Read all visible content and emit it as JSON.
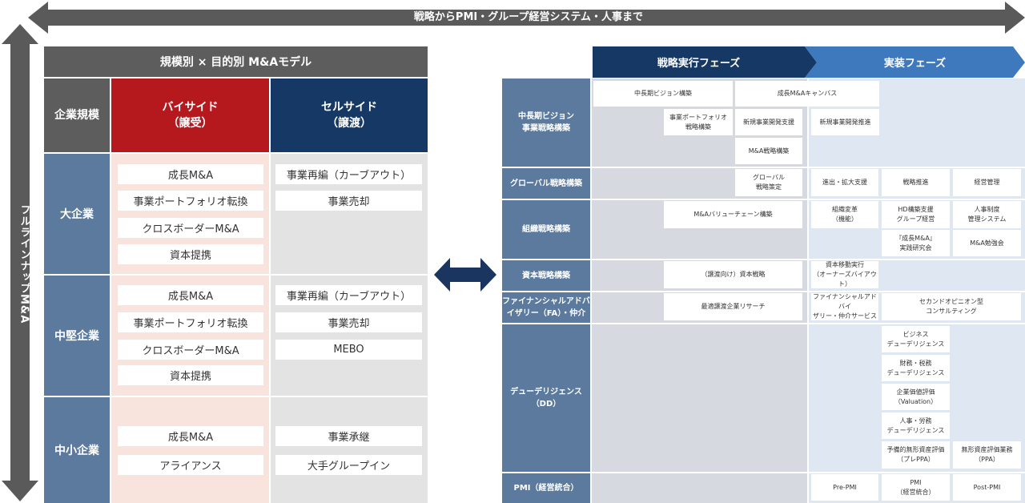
{
  "top_arrow_label": "戦略からPMI・グループ経営システム・人事まで",
  "left_arrow_label": "フルラインナップM&A",
  "model": {
    "title": "規模別 × 目的別 M&Aモデル",
    "header_scale": "企業規模",
    "buy_title": "バイサイド",
    "buy_sub": "（譲受）",
    "sell_title": "セルサイド",
    "sell_sub": "（譲渡）",
    "rows": [
      {
        "label": "大企業",
        "buy": [
          "成長M&A",
          "事業ポートフォリオ転換",
          "クロスボーダーM&A",
          "資本提携"
        ],
        "sell": [
          "事業再編（カーブアウト）",
          "事業売却"
        ]
      },
      {
        "label": "中堅企業",
        "buy": [
          "成長M&A",
          "事業ポートフォリオ転換",
          "クロスボーダーM&A",
          "資本提携"
        ],
        "sell": [
          "事業再編（カーブアウト）",
          "事業売却",
          "MEBO"
        ]
      },
      {
        "label": "中小企業",
        "buy": [
          "成長M&A",
          "アライアンス"
        ],
        "sell": [
          "事業承継",
          "大手グループイン"
        ]
      }
    ]
  },
  "phases": {
    "strategy": "戦略実行フェーズ",
    "implement": "実装フェーズ"
  },
  "process": {
    "rows": [
      {
        "label1": "中長期ビジョン",
        "label2": "事業戦略構築"
      },
      {
        "label1": "グローバル戦略構築",
        "label2": ""
      },
      {
        "label1": "組織戦略構築",
        "label2": ""
      },
      {
        "label1": "資本戦略構築",
        "label2": ""
      },
      {
        "label1": "ファイナンシャルアドバ",
        "label2": "イザリー（FA）・仲介"
      },
      {
        "label1": "デューデリジェンス",
        "label2": "（DD）"
      },
      {
        "label1": "PMI（経営統合）",
        "label2": ""
      }
    ],
    "items": {
      "vision_plan": "中長期ビジョン構築",
      "growth_canvas": "成長M&Aキャンバス",
      "portfolio_l1": "事業ポートフォリオ",
      "portfolio_l2": "戦略構築",
      "new_biz_support": "新規事業開発支援",
      "new_biz_promote": "新規事業開発推進",
      "ma_strategy": "M&A戦略構築",
      "global_l1": "グローバル",
      "global_l2": "戦略策定",
      "expansion": "進出・拡大支援",
      "strategy_promote": "戦略推進",
      "management": "経営管理",
      "value_chain": "M&Aバリューチェーン構築",
      "org_change_l1": "組織変革",
      "org_change_l2": "（機能）",
      "hd_l1": "HD構築支援",
      "hd_l2": "グループ経営",
      "hr_l1": "人事制度",
      "hr_l2": "管理システム",
      "study_l1": "『成長M&A』",
      "study_l2": "実践研究会",
      "study_meeting": "M&A勉強会",
      "capital_strategy": "（譲渡向け）資本戦略",
      "capital_move_l1": "資本移動実行",
      "capital_move_l2": "（オーナーズバイアウト）",
      "research": "最適譲渡企業リサーチ",
      "fa_l1": "ファイナンシャルアドバイ",
      "fa_l2": "ザリー・仲介サービス",
      "second_l1": "セカンドオピニオン型",
      "second_l2": "コンサルティング",
      "dd_biz_l1": "ビジネス",
      "dd_biz_l2": "デューデリジェンス",
      "dd_fin_l1": "財務・税務",
      "dd_fin_l2": "デューデリジェンス",
      "dd_val_l1": "企業価値評価",
      "dd_val_l2": "（Valuation）",
      "dd_hr_l1": "人事・労務",
      "dd_hr_l2": "デューデリジェンス",
      "preppa_l1": "予備的無形資産評価",
      "preppa_l2": "（プレPPA）",
      "ppa_l1": "無形資産評価業務",
      "ppa_l2": "（PPA）",
      "pre_pmi": "Pre-PMI",
      "pmi_l1": "PMI",
      "pmi_l2": "（経営統合）",
      "post_pmi": "Post-PMI"
    }
  },
  "colors": {
    "arrow_gray": "#5a5a5a",
    "row_blue": "#5b7a9d",
    "buy_red": "#b5191e",
    "sell_navy": "#163865",
    "phase_dark": "#163865",
    "phase_light": "#3f79bd",
    "middle_arrow": "#1a3560"
  }
}
